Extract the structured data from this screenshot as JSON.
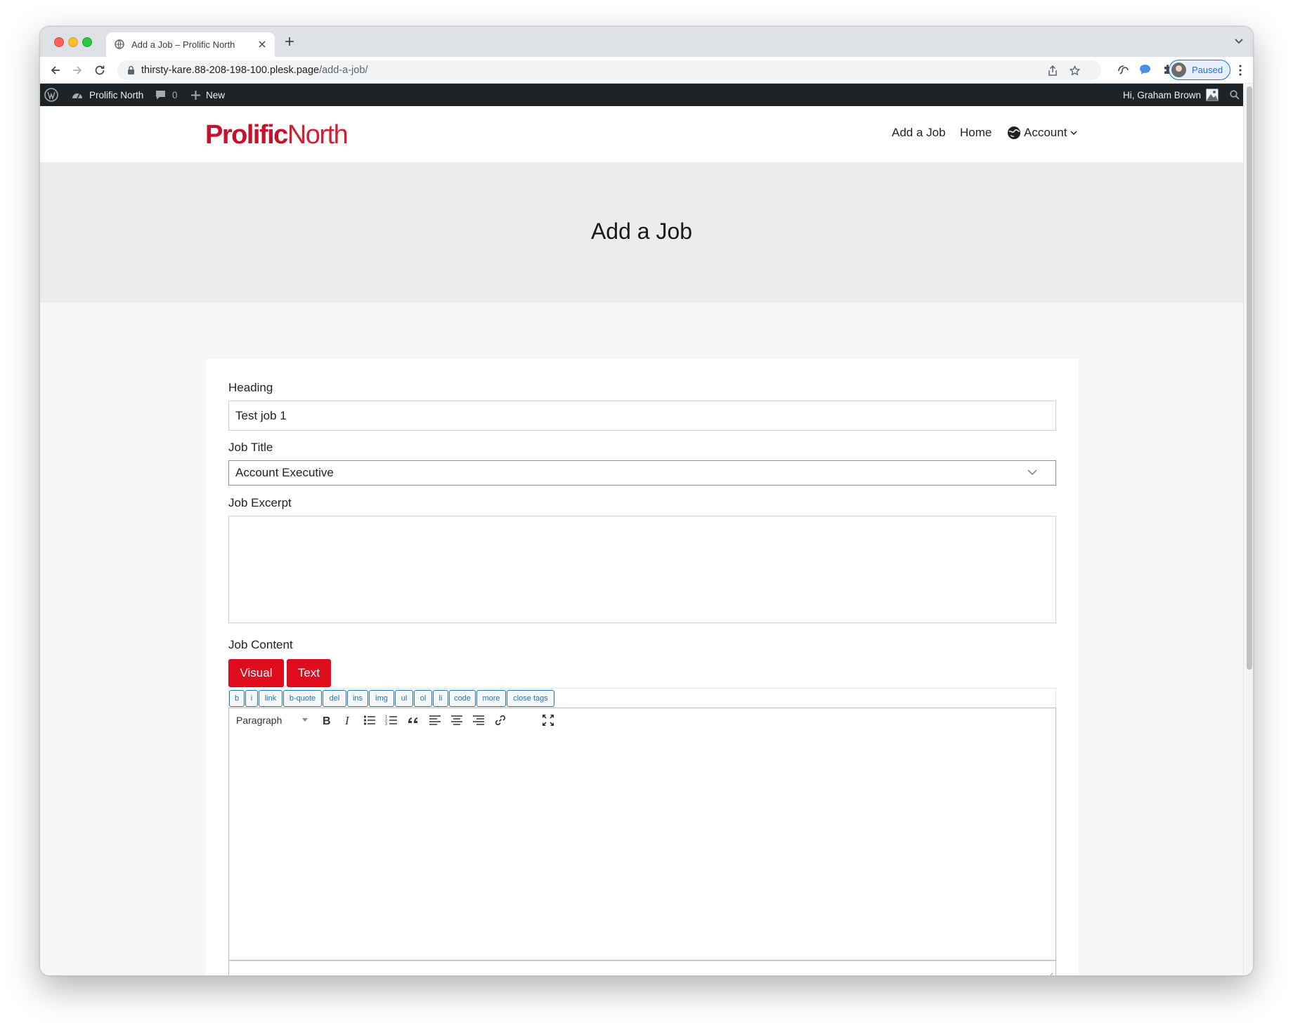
{
  "browser": {
    "tab_title": "Add a Job – Prolific North",
    "url_host": "thirsty-kare.88-208-198-100.plesk.page",
    "url_path": "/add-a-job/",
    "profile_label": "Paused"
  },
  "admin_bar": {
    "site_name": "Prolific North",
    "comments_count": "0",
    "new_label": "New",
    "greeting": "Hi, Graham Brown"
  },
  "site": {
    "logo_part1": "Prolific",
    "logo_part2": "North",
    "nav": [
      {
        "label": "Add a Job"
      },
      {
        "label": "Home"
      },
      {
        "label": "Account"
      }
    ]
  },
  "page": {
    "title": "Add a Job"
  },
  "form": {
    "heading_label": "Heading",
    "heading_value": "Test job 1",
    "job_title_label": "Job Title",
    "job_title_value": "Account Executive",
    "excerpt_label": "Job Excerpt",
    "excerpt_value": "",
    "content_label": "Job Content",
    "visual_tab": "Visual",
    "text_tab": "Text",
    "quicktags": [
      "b",
      "i",
      "link",
      "b-quote",
      "del",
      "ins",
      "img",
      "ul",
      "ol",
      "li",
      "code",
      "more",
      "close tags"
    ],
    "format_select": "Paragraph"
  },
  "colors": {
    "brand_red": "#e10b1e",
    "admin_bar_bg": "#1d2327",
    "quicktag_blue": "#2271b1"
  }
}
